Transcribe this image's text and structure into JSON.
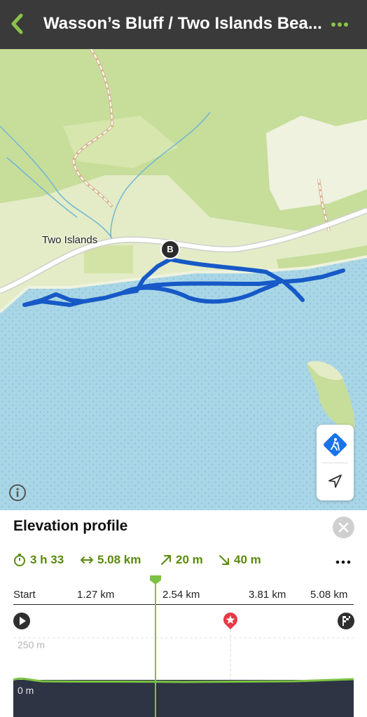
{
  "header": {
    "title": "Wasson’s Bluff / Two Islands Bea...",
    "accent": "#8bc34a",
    "background": "#3a3a3a"
  },
  "map": {
    "place_label": "Two Islands",
    "marker_label": "B",
    "route_color": "#1659c7",
    "water_color": "#a9d6e6",
    "land_color": "#e3ecc6",
    "forest_color": "#c7dd9a"
  },
  "elevation": {
    "title": "Elevation profile",
    "stats": {
      "duration": "3 h 33",
      "distance": "5.08 km",
      "ascent": "20 m",
      "descent": "40 m"
    },
    "distance_labels": [
      "Start",
      "1.27 km",
      "2.54 km",
      "3.81 km",
      "5.08 km"
    ],
    "elevation_labels": [
      "250 m",
      "0 m"
    ],
    "accent_color": "#5a8a0f",
    "slider_color": "#7cc243",
    "poi_color": "#e53946"
  }
}
